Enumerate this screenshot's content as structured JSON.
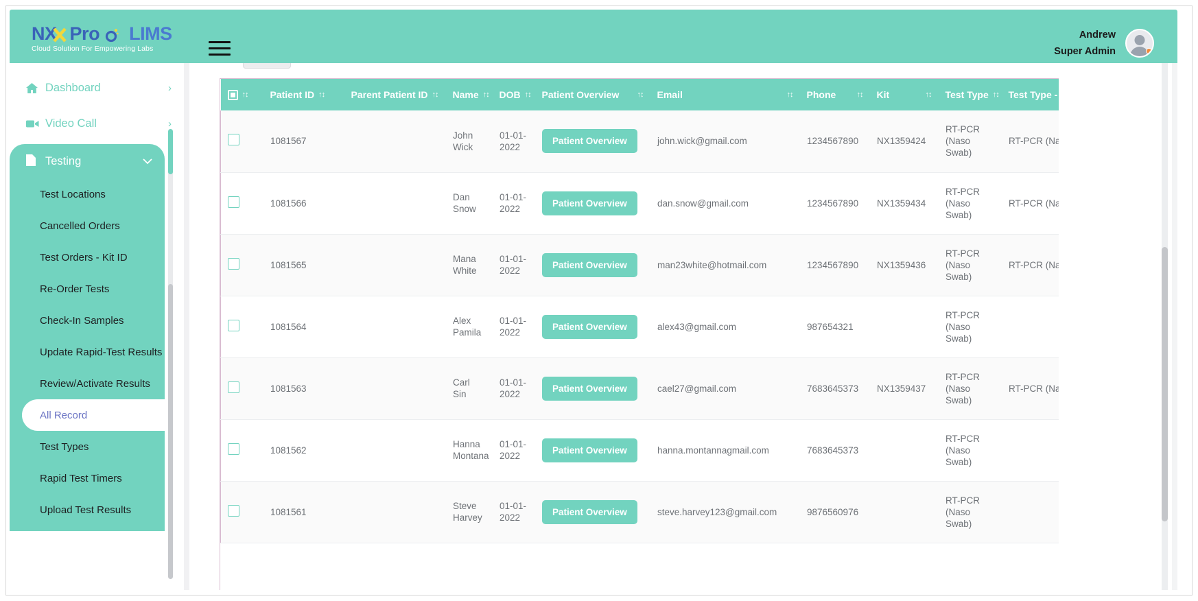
{
  "brand": {
    "logo_nx": "NX",
    "logo_x": "",
    "logo_pro": "Pro",
    "logo_lims": "LIMS",
    "tagline": "Cloud Solution For Empowering Labs",
    "accent": "#72d3bf",
    "logo_blue": "#3a63b8",
    "logo_yellow": "#f2d73a"
  },
  "topbar": {
    "menu_toggle": "hamburger-menu",
    "user_name": "Andrew",
    "user_role": "Super Admin"
  },
  "sidebar": {
    "top_items": [
      {
        "label": "Dashboard",
        "icon": "home-icon",
        "chevron": "›"
      },
      {
        "label": "Video Call",
        "icon": "video-camera-icon",
        "chevron": "›"
      }
    ],
    "group": {
      "label": "Testing",
      "icon": "document-icon",
      "chevron": "⌄",
      "expanded": true,
      "items": [
        {
          "label": "Test Locations",
          "active": false
        },
        {
          "label": "Cancelled Orders",
          "active": false
        },
        {
          "label": "Test Orders - Kit ID",
          "active": false
        },
        {
          "label": "Re-Order Tests",
          "active": false
        },
        {
          "label": "Check-In Samples",
          "active": false
        },
        {
          "label": "Update Rapid-Test Results",
          "active": false
        },
        {
          "label": "Review/Activate Results",
          "active": false
        },
        {
          "label": "All Record",
          "active": true
        },
        {
          "label": "Test Types",
          "active": false
        },
        {
          "label": "Rapid Test Timers",
          "active": false
        },
        {
          "label": "Upload Test Results",
          "active": false
        }
      ]
    }
  },
  "table": {
    "sort_glyph": "↑↕",
    "columns": [
      {
        "key": "check",
        "label": "",
        "sortable": true,
        "select_all": true
      },
      {
        "key": "pid",
        "label": "Patient ID",
        "sortable": true
      },
      {
        "key": "ppid",
        "label": "Parent Patient ID",
        "sortable": true
      },
      {
        "key": "name",
        "label": "Name",
        "sortable": true
      },
      {
        "key": "dob",
        "label": "DOB",
        "sortable": true
      },
      {
        "key": "ov",
        "label": "Patient Overview",
        "sortable": true
      },
      {
        "key": "email",
        "label": "Email",
        "sortable": true
      },
      {
        "key": "phone",
        "label": "Phone",
        "sortable": true
      },
      {
        "key": "kit",
        "label": "Kit",
        "sortable": true
      },
      {
        "key": "tt",
        "label": "Test Type",
        "sortable": true
      },
      {
        "key": "ttk",
        "label": "Test Type - Kits",
        "sortable": false
      }
    ],
    "overview_button_label": "Patient Overview",
    "rows": [
      {
        "pid": "1081567",
        "ppid": "",
        "name": "John Wick",
        "dob": "01-01-2022",
        "email": "john.wick@gmail.com",
        "phone": "1234567890",
        "kit": "NX1359424",
        "test_type": "RT-PCR (Naso Swab)",
        "test_type_kits": "RT-PCR (Naso Swab) -"
      },
      {
        "pid": "1081566",
        "ppid": "",
        "name": "Dan Snow",
        "dob": "01-01-2022",
        "email": "dan.snow@gmail.com",
        "phone": "1234567890",
        "kit": "NX1359434",
        "test_type": "RT-PCR (Naso Swab)",
        "test_type_kits": "RT-PCR (Naso Swab) -"
      },
      {
        "pid": "1081565",
        "ppid": "",
        "name": "Mana White",
        "dob": "01-01-2022",
        "email": "man23white@hotmail.com",
        "phone": "1234567890",
        "kit": "NX1359436",
        "test_type": "RT-PCR (Naso Swab)",
        "test_type_kits": "RT-PCR (Naso Swab) -"
      },
      {
        "pid": "1081564",
        "ppid": "",
        "name": "Alex Pamila",
        "dob": "01-01-2022",
        "email": "alex43@gmail.com",
        "phone": "987654321",
        "kit": "",
        "test_type": "RT-PCR (Naso Swab)",
        "test_type_kits": ""
      },
      {
        "pid": "1081563",
        "ppid": "",
        "name": "Carl Sin",
        "dob": "01-01-2022",
        "email": "cael27@gmail.com",
        "phone": "7683645373",
        "kit": "NX1359437",
        "test_type": "RT-PCR (Naso Swab)",
        "test_type_kits": "RT-PCR (Naso Swab) -"
      },
      {
        "pid": "1081562",
        "ppid": "",
        "name": "Hanna Montana",
        "dob": "01-01-2022",
        "email": "hanna.montannagmail.com",
        "phone": "7683645373",
        "kit": "",
        "test_type": "RT-PCR (Naso Swab)",
        "test_type_kits": ""
      },
      {
        "pid": "1081561",
        "ppid": "",
        "name": "Steve Harvey",
        "dob": "01-01-2022",
        "email": "steve.harvey123@gmail.com",
        "phone": "9876560976",
        "kit": "",
        "test_type": "RT-PCR (Naso Swab)",
        "test_type_kits": ""
      }
    ]
  }
}
